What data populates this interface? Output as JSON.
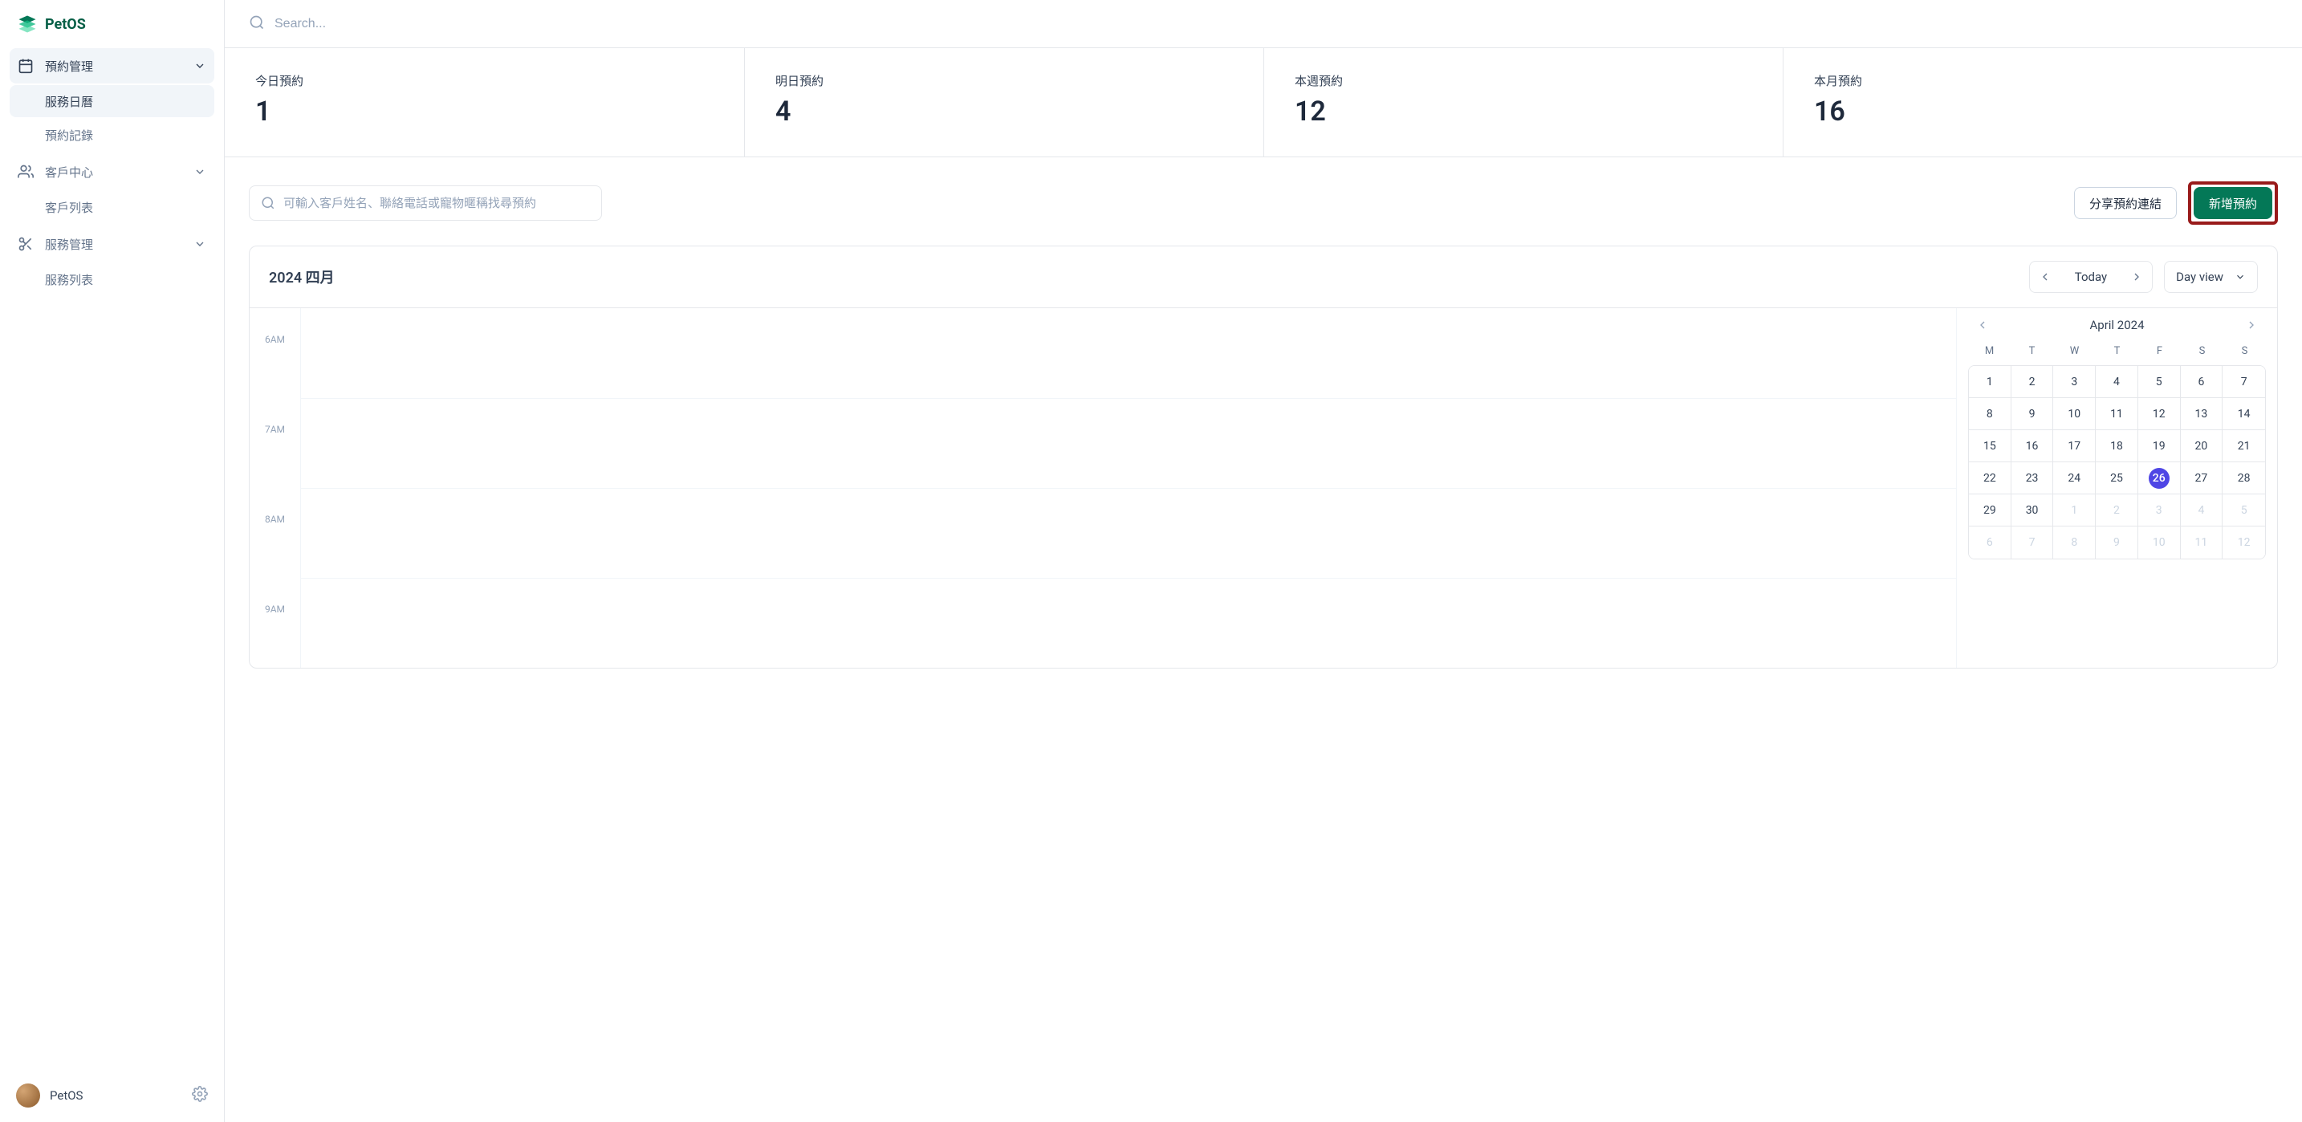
{
  "app_name": "PetOS",
  "search_placeholder": "Search...",
  "sidebar": {
    "sections": [
      {
        "label": "預約管理",
        "subs": [
          "服務日曆",
          "預約記錄"
        ]
      },
      {
        "label": "客戶中心",
        "subs": [
          "客戶列表"
        ]
      },
      {
        "label": "服務管理",
        "subs": [
          "服務列表"
        ]
      }
    ],
    "footer_name": "PetOS"
  },
  "stats": [
    {
      "label": "今日預約",
      "value": "1"
    },
    {
      "label": "明日預約",
      "value": "4"
    },
    {
      "label": "本週預約",
      "value": "12"
    },
    {
      "label": "本月預約",
      "value": "16"
    }
  ],
  "toolbar": {
    "search_placeholder": "可輸入客戶姓名、聯絡電話或寵物暱稱找尋預約",
    "share_label": "分享預約連結",
    "new_label": "新增預約"
  },
  "calendar": {
    "title": "2024 四月",
    "today_label": "Today",
    "view_label": "Day view",
    "times": [
      "6AM",
      "7AM",
      "8AM",
      "9AM"
    ],
    "mini_title": "April 2024",
    "dow": [
      "M",
      "T",
      "W",
      "T",
      "F",
      "S",
      "S"
    ],
    "days": [
      [
        "1",
        "2",
        "3",
        "4",
        "5",
        "6",
        "7"
      ],
      [
        "8",
        "9",
        "10",
        "11",
        "12",
        "13",
        "14"
      ],
      [
        "15",
        "16",
        "17",
        "18",
        "19",
        "20",
        "21"
      ],
      [
        "22",
        "23",
        "24",
        "25",
        "26",
        "27",
        "28"
      ],
      [
        "29",
        "30",
        "1",
        "2",
        "3",
        "4",
        "5"
      ],
      [
        "6",
        "7",
        "8",
        "9",
        "10",
        "11",
        "12"
      ]
    ],
    "selected_day": "26",
    "muted_start_row": 4,
    "muted_start_col": 2
  }
}
